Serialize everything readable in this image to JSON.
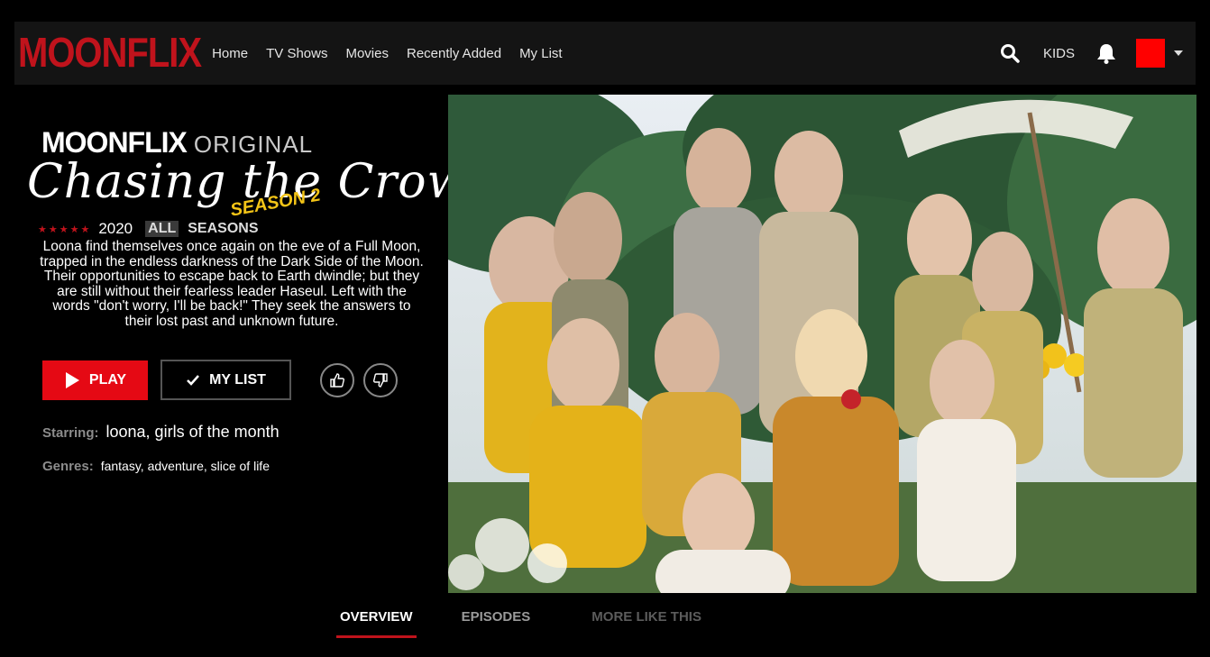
{
  "brand": {
    "logo_text": "MOONFLIX",
    "accent": "#e50914",
    "logo_color": "#c0131c"
  },
  "nav": {
    "links": [
      "Home",
      "TV Shows",
      "Movies",
      "Recently Added",
      "My List"
    ],
    "kids_label": "KIDS",
    "icons": {
      "search": "search-icon",
      "bell": "bell-icon",
      "avatar_color": "#ff0000"
    }
  },
  "show": {
    "brand_badge": "MOONFLIX",
    "original_label": "ORIGINAL",
    "title": "Chasing the Crown",
    "season_tag": "SEASON 2",
    "stars": "★★★★★",
    "year": "2020",
    "rating": "ALL",
    "seasons": "SEASONS",
    "description": "Loona find themselves once again on the eve of a Full Moon, trapped in the endless darkness of the Dark Side of the Moon. Their opportunities to escape back to Earth dwindle; but they are still without their fearless leader Haseul. Left with the words \"don't worry, I'll be back!\" They seek the answers to their lost past and unknown future.",
    "play_label": "PLAY",
    "mylist_label": "MY LIST",
    "starring_label": "Starring:",
    "starring_value": "loona, girls of the month",
    "genres_label": "Genres:",
    "genres_value": "fantasy, adventure, slice of life"
  },
  "tabs": [
    {
      "label": "OVERVIEW",
      "state": "active"
    },
    {
      "label": "EPISODES",
      "state": "inactive"
    },
    {
      "label": "MORE LIKE THIS",
      "state": "dim"
    }
  ]
}
